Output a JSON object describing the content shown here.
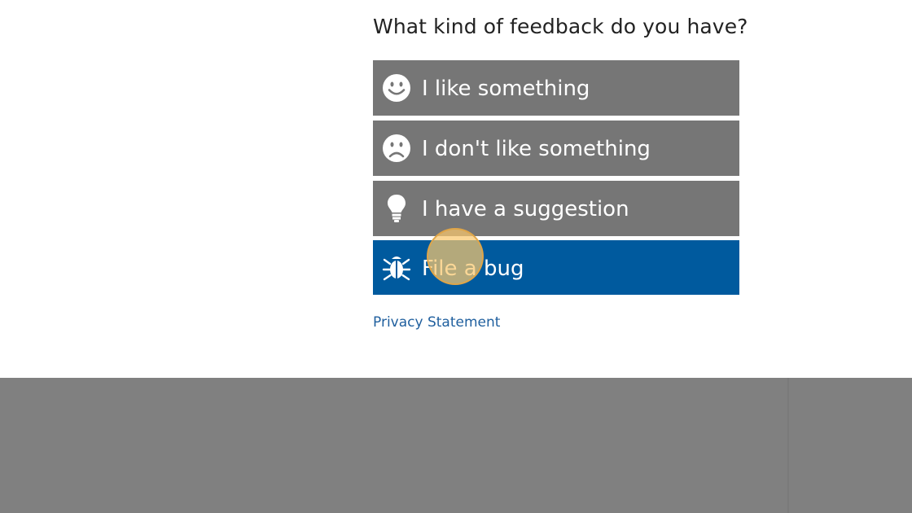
{
  "heading": "What kind of feedback do you have?",
  "options": [
    {
      "label": "I like something",
      "icon": "smiley-face-icon"
    },
    {
      "label": "I don't like something",
      "icon": "frowning-face-icon"
    },
    {
      "label": "I have a suggestion",
      "icon": "lightbulb-icon"
    },
    {
      "label": "File a bug",
      "icon": "bug-icon",
      "selected": true
    }
  ],
  "privacy_link": "Privacy Statement",
  "colors": {
    "option_background": "#767676",
    "selected_background": "#005a9e",
    "link": "#1f5f9e",
    "backdrop": "#808080"
  }
}
